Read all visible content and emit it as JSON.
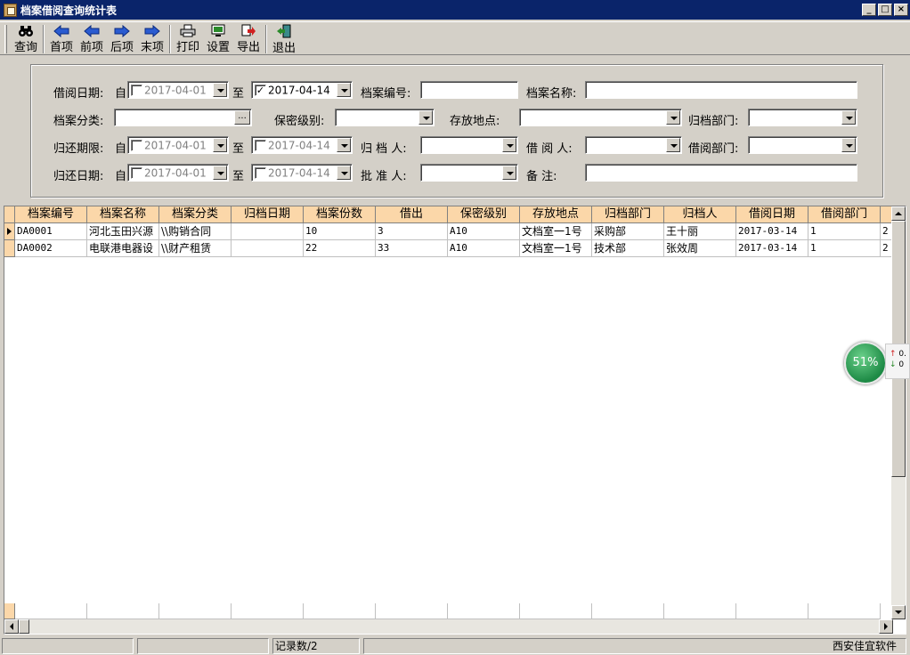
{
  "window": {
    "title": "档案借阅查询统计表"
  },
  "toolbar": {
    "items": [
      {
        "label": "查询"
      },
      {
        "label": "首项"
      },
      {
        "label": "前项"
      },
      {
        "label": "后项"
      },
      {
        "label": "末项"
      },
      {
        "label": "打印"
      },
      {
        "label": "设置"
      },
      {
        "label": "导出"
      },
      {
        "label": "退出"
      }
    ]
  },
  "filters": {
    "borrow_date_label": "借阅日期:",
    "from": "自",
    "to": "至",
    "borrow_from": "2017-04-01",
    "borrow_to": "2017-04-14",
    "archive_no_label": "档案编号:",
    "archive_name_label": "档案名称:",
    "category_label": "档案分类:",
    "secret_label": "保密级别:",
    "location_label": "存放地点:",
    "dept_label": "归档部门:",
    "due_label": "归还期限:",
    "due_from": "2017-04-01",
    "due_to": "2017-04-14",
    "archiver_label": "归 档 人:",
    "borrower_label": "借 阅 人:",
    "borrow_dept_label": "借阅部门:",
    "return_label": "归还日期:",
    "return_from": "2017-04-01",
    "return_to": "2017-04-14",
    "approver_label": "批 准 人:",
    "remark_label": "备    注:",
    "ellipsis": "..."
  },
  "grid": {
    "columns": [
      "档案编号",
      "档案名称",
      "档案分类",
      "归档日期",
      "档案份数",
      "借出",
      "保密级别",
      "存放地点",
      "归档部门",
      "归档人",
      "借阅日期",
      "借阅部门",
      ""
    ],
    "rows": [
      [
        "DA0001",
        "河北玉田兴源",
        "\\\\购销合同",
        "",
        "10",
        "3",
        "A10",
        "文档室一1号",
        "采购部",
        "王十丽",
        "2017-03-14",
        "1",
        "2"
      ],
      [
        "DA0002",
        "电联港电器设",
        "\\\\财产租赁",
        "",
        "22",
        "33",
        "A10",
        "文档室一1号",
        "技术部",
        "张效周",
        "2017-03-14",
        "1",
        "2"
      ]
    ]
  },
  "status": {
    "record_count": "记录数/2",
    "company": "西安佳宜软件"
  },
  "perf_widget": {
    "percent": "51%",
    "up": "0.",
    "down": "0"
  }
}
